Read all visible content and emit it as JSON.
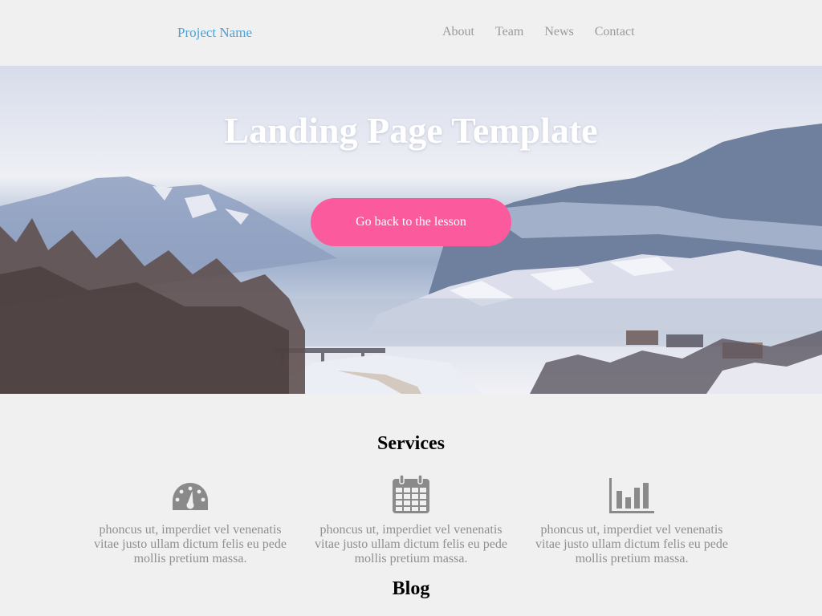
{
  "nav": {
    "brand": "Project Name",
    "links": [
      "About",
      "Team",
      "News",
      "Contact"
    ]
  },
  "hero": {
    "title": "Landing Page Template",
    "button_label": "Go back to the lesson",
    "button_color": "#fb5b9c"
  },
  "services": {
    "title": "Services",
    "items": [
      {
        "icon": "dashboard-icon",
        "text": "phoncus ut, imperdiet vel venenatis vitae justo ullam dictum felis eu pede mollis pretium massa."
      },
      {
        "icon": "calendar-icon",
        "text": "phoncus ut, imperdiet vel venenatis vitae justo ullam dictum felis eu pede mollis pretium massa."
      },
      {
        "icon": "bar-chart-icon",
        "text": "phoncus ut, imperdiet vel venenatis vitae justo ullam dictum felis eu pede mollis pretium massa."
      }
    ]
  },
  "blog": {
    "title": "Blog"
  },
  "colors": {
    "brand": "#4aa3d8",
    "nav_link": "#9a9a9a",
    "icon": "#8a8a8a",
    "body_text": "#8f8f8f"
  }
}
